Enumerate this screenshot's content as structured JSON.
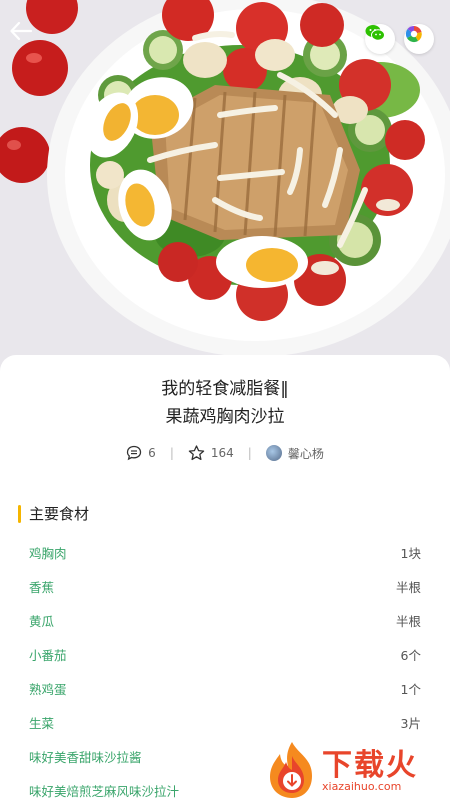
{
  "recipe": {
    "title_line1": "我的轻食减脂餐‖",
    "title_line2": "果蔬鸡胸肉沙拉",
    "comments_count": "6",
    "favorites_count": "164",
    "author": "馨心杨"
  },
  "section": {
    "title": "主要食材"
  },
  "ingredients": [
    {
      "name": "鸡胸肉",
      "qty": "1块"
    },
    {
      "name": "香蕉",
      "qty": "半根"
    },
    {
      "name": "黄瓜",
      "qty": "半根"
    },
    {
      "name": "小番茄",
      "qty": "6个"
    },
    {
      "name": "熟鸡蛋",
      "qty": "1个"
    },
    {
      "name": "生菜",
      "qty": "3片"
    },
    {
      "name": "味好美香甜味沙拉酱",
      "qty": ""
    },
    {
      "name": "味好美焙煎芝麻风味沙拉汁",
      "qty": ""
    }
  ],
  "watermark": {
    "text": "下载火",
    "url": "xiazaihuo.com"
  },
  "colors": {
    "accent_bar": "#f5b500",
    "ingredient_name": "#3aa56b",
    "wechat_green": "#2dc100",
    "watermark_red": "#e8452b"
  },
  "icons": {
    "back": "back-arrow-icon",
    "wechat": "wechat-icon",
    "moments": "moments-icon",
    "comment": "comment-icon",
    "star": "star-icon"
  }
}
